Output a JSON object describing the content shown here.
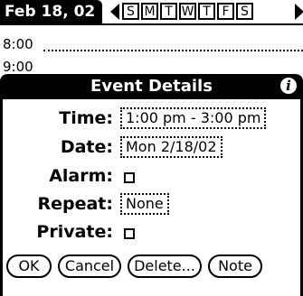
{
  "header": {
    "date_label": "Feb 18, 02",
    "week_days": [
      "S",
      "M",
      "T",
      "W",
      "T",
      "F",
      "S"
    ]
  },
  "day_view": {
    "rows": [
      {
        "time": "8:00"
      },
      {
        "time": "9:00"
      }
    ]
  },
  "dialog": {
    "title": "Event Details",
    "info_icon": "info-icon",
    "fields": {
      "time_label": "Time:",
      "time_value": "1:00 pm - 3:00 pm",
      "date_label": "Date:",
      "date_value": "Mon 2/18/02",
      "alarm_label": "Alarm:",
      "repeat_label": "Repeat:",
      "repeat_value": "None",
      "private_label": "Private:"
    },
    "buttons": {
      "ok": "OK",
      "cancel": "Cancel",
      "delete": "Delete...",
      "note": "Note"
    }
  }
}
